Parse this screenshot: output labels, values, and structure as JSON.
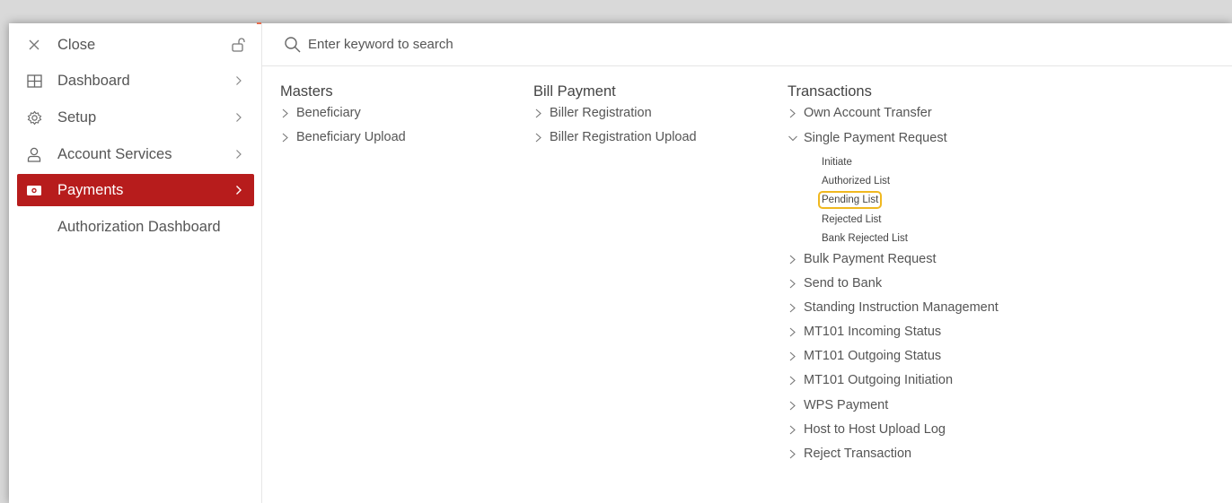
{
  "sidebar": {
    "items": [
      {
        "label": "Close",
        "icon": "close-icon"
      },
      {
        "label": "Dashboard",
        "icon": "dashboard-grid-icon"
      },
      {
        "label": "Setup",
        "icon": "gear-icon"
      },
      {
        "label": "Account Services",
        "icon": "user-icon"
      },
      {
        "label": "Payments",
        "icon": "payments-icon"
      }
    ],
    "sub_item": "Authorization Dashboard",
    "active_color": "#b71c1c"
  },
  "search": {
    "placeholder": "Enter keyword to search"
  },
  "menu": {
    "masters": {
      "title": "Masters",
      "items": [
        "Beneficiary",
        "Beneficiary Upload"
      ]
    },
    "bill_payment": {
      "title": "Bill Payment",
      "items": [
        "Biller Registration",
        "Biller Registration Upload"
      ]
    },
    "transactions": {
      "title": "Transactions",
      "items": [
        "Own Account Transfer",
        "Single Payment Request",
        "Bulk Payment Request",
        "Send to Bank",
        "Standing Instruction Management",
        "MT101 Incoming Status",
        "MT101 Outgoing Status",
        "MT101 Outgoing Initiation",
        "WPS Payment",
        "Host to Host Upload Log",
        "Reject Transaction"
      ],
      "single_payment_sub": [
        "Initiate",
        "Authorized List",
        "Pending List",
        "Rejected List",
        "Bank Rejected List"
      ],
      "highlighted_sub": "Pending List",
      "highlight_color": "#f0b820"
    }
  }
}
